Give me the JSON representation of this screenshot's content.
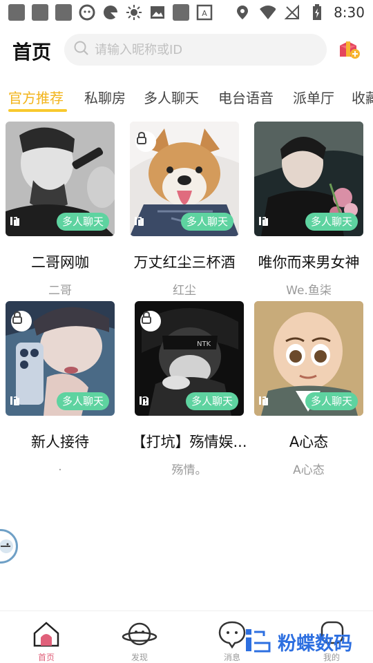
{
  "status_bar": {
    "time": "8:30"
  },
  "header": {
    "title": "首页",
    "search_placeholder": "请输入昵称或ID"
  },
  "tabs": [
    {
      "label": "官方推荐",
      "active": true
    },
    {
      "label": "私聊房"
    },
    {
      "label": "多人聊天"
    },
    {
      "label": "电台语音"
    },
    {
      "label": "派单厅"
    },
    {
      "label": "收藏"
    }
  ],
  "rooms": [
    {
      "name": "二哥网咖",
      "owner": "二哥",
      "count": "1",
      "tag": "多人聊天",
      "locked": false
    },
    {
      "name": "万丈红尘三杯酒",
      "owner": "红尘",
      "count": "1",
      "tag": "多人聊天",
      "locked": true
    },
    {
      "name": "唯你而来男女神",
      "owner": "We.鱼柒",
      "count": "1",
      "tag": "多人聊天",
      "locked": false
    },
    {
      "name": "新人接待",
      "owner": ".",
      "count": "1",
      "tag": "多人聊天",
      "locked": true
    },
    {
      "name": "【打坑】殇情娱...",
      "owner": "殇情。",
      "count": "2",
      "tag": "多人聊天",
      "locked": true
    },
    {
      "name": "A心态",
      "owner": "A心态",
      "count": "1",
      "tag": "多人聊天",
      "locked": false
    }
  ],
  "bottom_nav": [
    {
      "label": "首页",
      "active": true
    },
    {
      "label": "发现"
    },
    {
      "label": "消息"
    },
    {
      "label": "我的"
    }
  ],
  "watermark": {
    "text": "粉蝶数码"
  },
  "colors": {
    "accent": "#f2b41b",
    "tag": "#5ed3a0",
    "nav_active": "#e0607a",
    "watermark": "#2d6fe0"
  }
}
